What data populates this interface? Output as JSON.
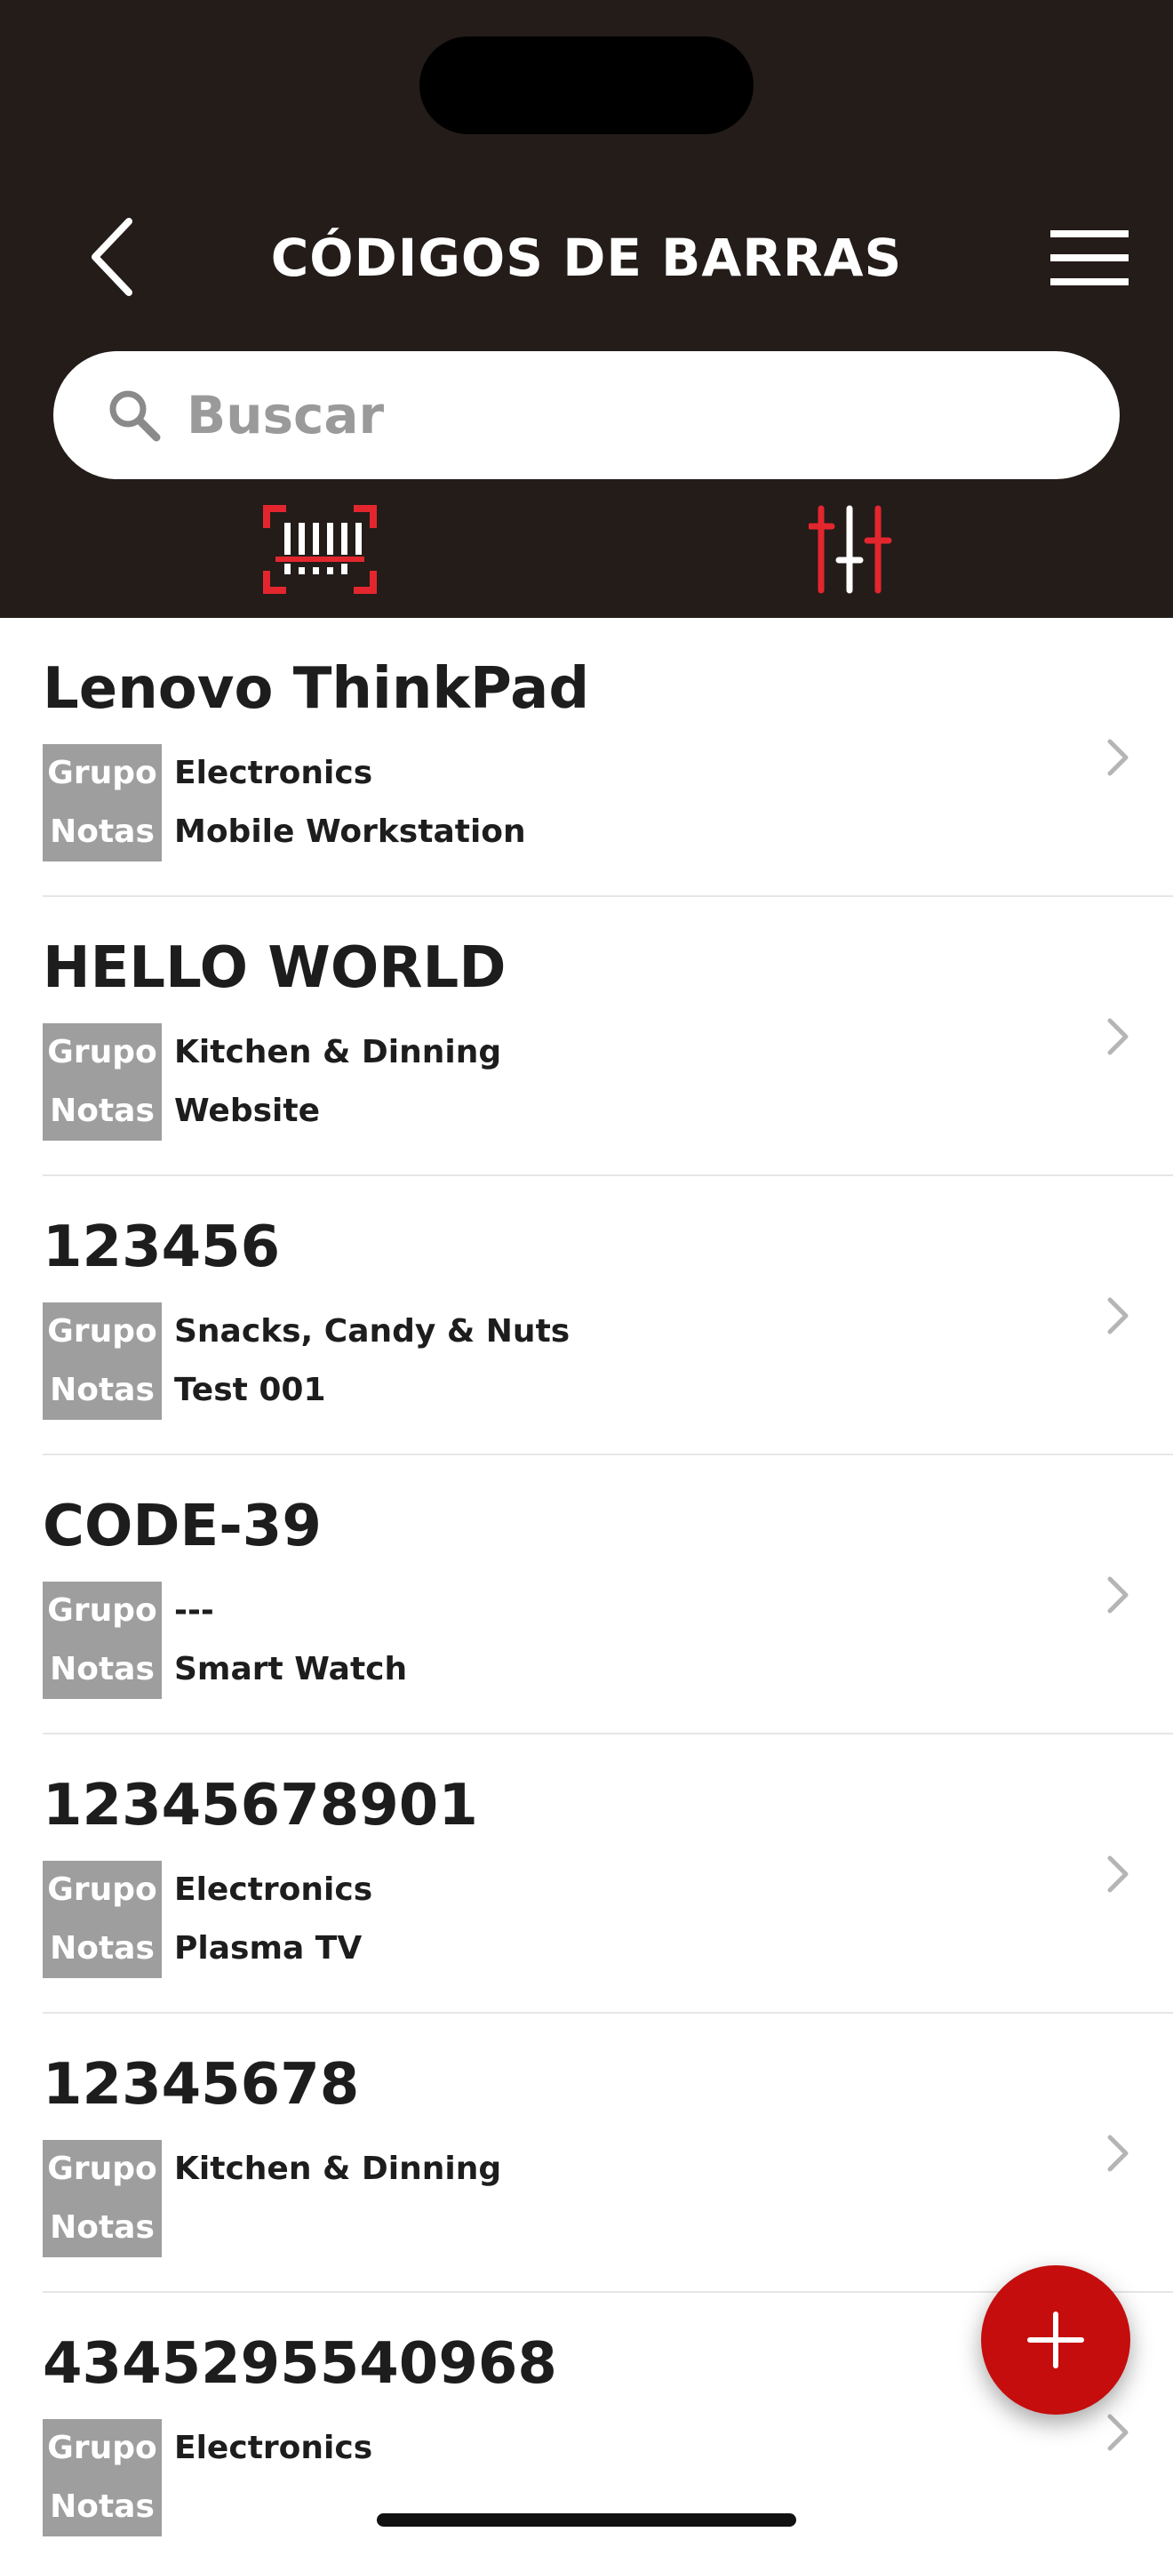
{
  "header": {
    "title": "CÓDIGOS DE BARRAS",
    "back_icon": "chevron-left-icon",
    "menu_icon": "hamburger-menu-icon"
  },
  "search": {
    "placeholder": "Buscar",
    "value": ""
  },
  "toolbar": {
    "scan_icon": "barcode-scan-icon",
    "filter_icon": "sliders-filter-icon"
  },
  "colors": {
    "header_bg": "#231c19",
    "accent": "#e3262e",
    "fab": "#c50d0d",
    "label_bg": "#9e9e9e"
  },
  "labels": {
    "group": "Grupo",
    "notes": "Notas"
  },
  "items": [
    {
      "title": "Lenovo ThinkPad",
      "group": "Electronics",
      "notes": "Mobile Workstation"
    },
    {
      "title": "HELLO WORLD",
      "group": "Kitchen & Dinning",
      "notes": "Website"
    },
    {
      "title": "123456",
      "group": "Snacks, Candy & Nuts",
      "notes": "Test 001"
    },
    {
      "title": "CODE-39",
      "group": "---",
      "notes": "Smart Watch"
    },
    {
      "title": "12345678901",
      "group": "Electronics",
      "notes": "Plasma TV"
    },
    {
      "title": "12345678",
      "group": "Kitchen & Dinning",
      "notes": ""
    },
    {
      "title": "4345295540968",
      "group": "Electronics",
      "notes": ""
    }
  ],
  "fab": {
    "icon": "plus-icon"
  }
}
